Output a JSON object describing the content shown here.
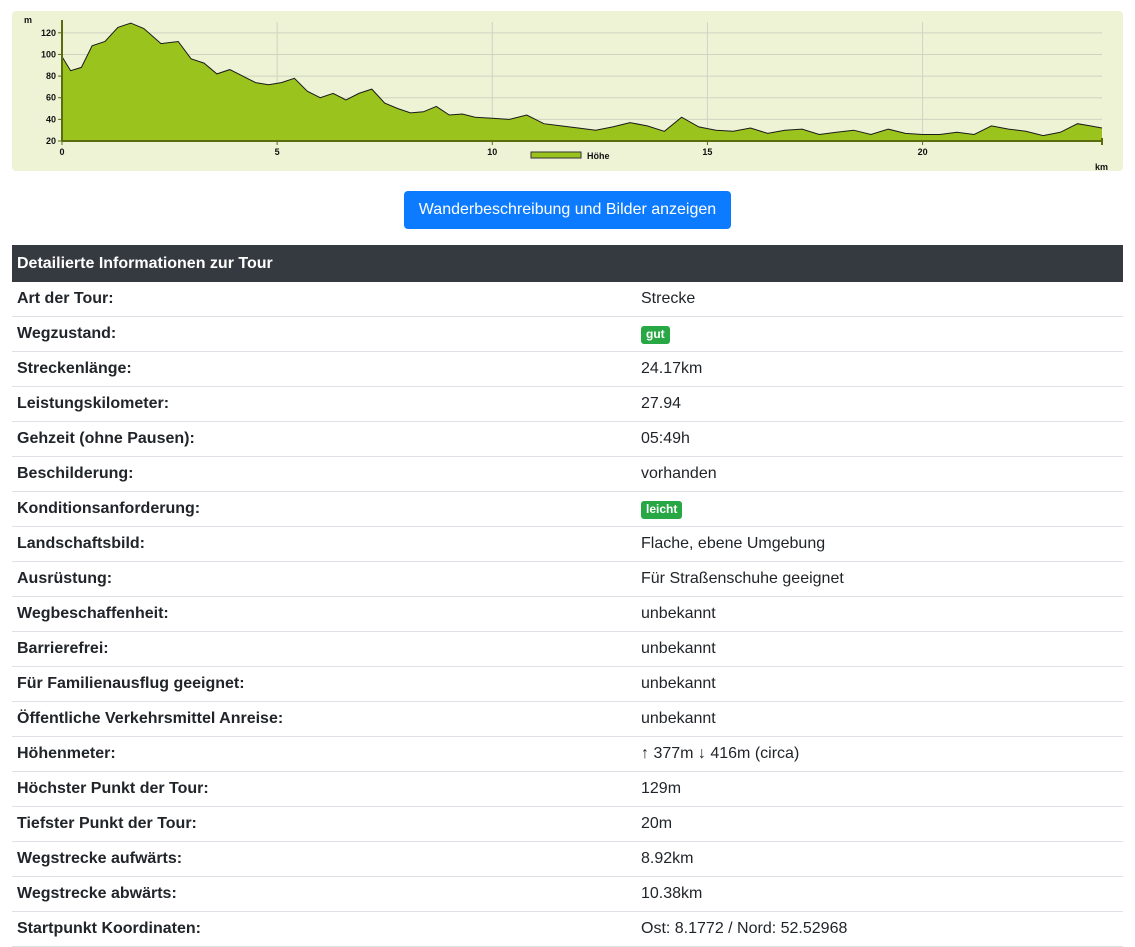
{
  "chart_data": {
    "type": "area",
    "title": "",
    "xlabel": "km",
    "ylabel": "m",
    "xlim": [
      0,
      24.17
    ],
    "ylim": [
      20,
      130
    ],
    "x_ticks": [
      0,
      5,
      10,
      15,
      20
    ],
    "y_ticks": [
      20,
      40,
      60,
      80,
      100,
      120
    ],
    "legend": "Höhe",
    "legend_position": "bottom-center",
    "grid": true,
    "fill_color": "#9bc31e",
    "series": [
      {
        "name": "Höhe",
        "x": [
          0,
          0.2,
          0.45,
          0.7,
          1.0,
          1.3,
          1.6,
          1.9,
          2.3,
          2.7,
          3.0,
          3.3,
          3.6,
          3.9,
          4.2,
          4.5,
          4.8,
          5.1,
          5.4,
          5.7,
          6.0,
          6.3,
          6.6,
          6.9,
          7.2,
          7.5,
          7.8,
          8.1,
          8.4,
          8.7,
          9.0,
          9.3,
          9.6,
          10.0,
          10.4,
          10.8,
          11.2,
          11.6,
          12.0,
          12.4,
          12.8,
          13.2,
          13.6,
          14.0,
          14.4,
          14.8,
          15.2,
          15.6,
          16.0,
          16.4,
          16.8,
          17.2,
          17.6,
          18.0,
          18.4,
          18.8,
          19.2,
          19.6,
          20.0,
          20.4,
          20.8,
          21.2,
          21.6,
          22.0,
          22.4,
          22.8,
          23.2,
          23.6,
          23.9,
          24.17
        ],
        "y": [
          98,
          85,
          88,
          108,
          112,
          125,
          129,
          124,
          110,
          112,
          96,
          92,
          82,
          86,
          80,
          74,
          72,
          74,
          78,
          66,
          60,
          64,
          58,
          64,
          68,
          55,
          50,
          46,
          47,
          52,
          44,
          45,
          42,
          41,
          40,
          44,
          36,
          34,
          32,
          30,
          33,
          37,
          34,
          29,
          42,
          33,
          30,
          29,
          32,
          27,
          30,
          31,
          26,
          28,
          30,
          26,
          31,
          27,
          26,
          26,
          28,
          26,
          34,
          31,
          29,
          25,
          28,
          36,
          34,
          32
        ]
      }
    ]
  },
  "actions": {
    "show_description_label": "Wanderbeschreibung und Bilder anzeigen"
  },
  "info_table": {
    "header": "Detailierte Informationen zur Tour",
    "rows": [
      {
        "label": "Art der Tour:",
        "value": "Strecke",
        "badge": false
      },
      {
        "label": "Wegzustand:",
        "value": "gut",
        "badge": true
      },
      {
        "label": "Streckenlänge:",
        "value": "24.17km",
        "badge": false
      },
      {
        "label": "Leistungskilometer:",
        "value": "27.94",
        "badge": false
      },
      {
        "label": "Gehzeit (ohne Pausen):",
        "value": "05:49h",
        "badge": false
      },
      {
        "label": "Beschilderung:",
        "value": "vorhanden",
        "badge": false
      },
      {
        "label": "Konditionsanforderung:",
        "value": "leicht",
        "badge": true
      },
      {
        "label": "Landschaftsbild:",
        "value": "Flache, ebene Umgebung",
        "badge": false
      },
      {
        "label": "Ausrüstung:",
        "value": "Für Straßenschuhe geeignet",
        "badge": false
      },
      {
        "label": "Wegbeschaffenheit:",
        "value": "unbekannt",
        "badge": false
      },
      {
        "label": "Barrierefrei:",
        "value": "unbekannt",
        "badge": false
      },
      {
        "label": "Für Familienausflug geeignet:",
        "value": "unbekannt",
        "badge": false
      },
      {
        "label": "Öffentliche Verkehrsmittel Anreise:",
        "value": "unbekannt",
        "badge": false
      },
      {
        "label": "Höhenmeter:",
        "value": "↑ 377m ↓ 416m (circa)",
        "badge": false
      },
      {
        "label": "Höchster Punkt der Tour:",
        "value": "129m",
        "badge": false
      },
      {
        "label": "Tiefster Punkt der Tour:",
        "value": "20m",
        "badge": false
      },
      {
        "label": "Wegstrecke aufwärts:",
        "value": "8.92km",
        "badge": false
      },
      {
        "label": "Wegstrecke abwärts:",
        "value": "10.38km",
        "badge": false
      },
      {
        "label": "Startpunkt Koordinaten:",
        "value": "Ost: 8.1772 / Nord: 52.52968",
        "badge": false
      }
    ]
  }
}
